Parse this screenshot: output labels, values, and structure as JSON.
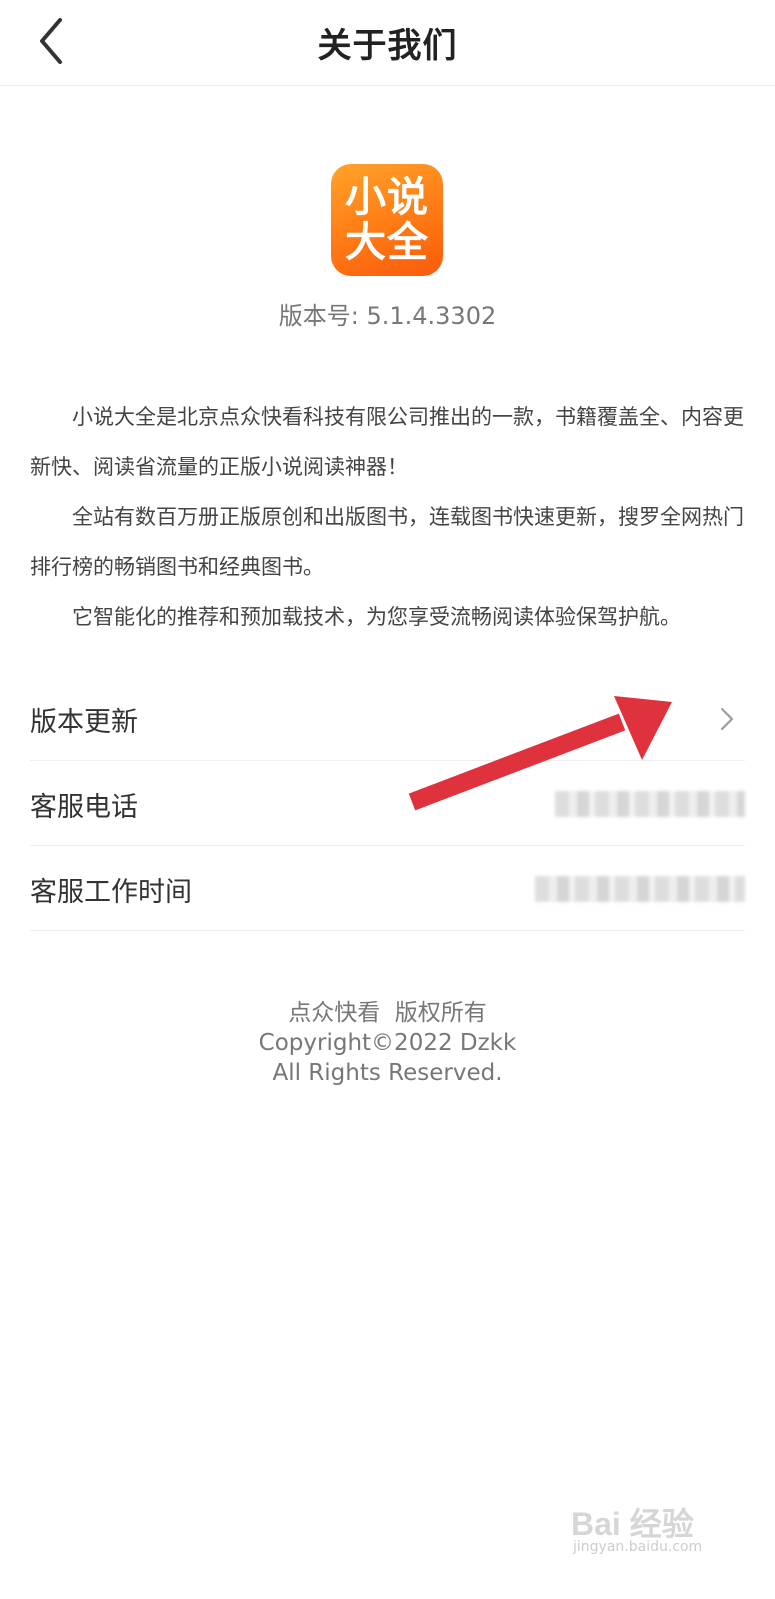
{
  "header": {
    "title": "关于我们",
    "back_icon": "chevron-left-icon"
  },
  "app": {
    "logo_line1": "小说",
    "logo_line2": "大全",
    "version_text": "版本号: 5.1.4.3302"
  },
  "description": {
    "paragraphs": [
      "小说大全是北京点众快看科技有限公司推出的一款，书籍覆盖全、内容更新快、阅读省流量的正版小说阅读神器！",
      "全站有数百万册正版原创和出版图书，连载图书快速更新，搜罗全网热门排行榜的畅销图书和经典图书。",
      "它智能化的推荐和预加载技术，为您享受流畅阅读体验保驾护航。"
    ]
  },
  "list": {
    "items": [
      {
        "label": "版本更新",
        "icon": "chevron-right-icon"
      },
      {
        "label": "客服电话"
      },
      {
        "label": "客服工作时间"
      }
    ]
  },
  "footer": {
    "line1": "点众快看  版权所有",
    "line2": "Copyright©2022 Dzkk",
    "line3": "All Rights Reserved."
  },
  "watermark": {
    "text": "Bai 经验",
    "sub": "jingyan.baidu.com"
  },
  "colors": {
    "logo_orange": "#ff7a14",
    "arrow_red": "#e0323c",
    "text_dark": "#333333",
    "text_gray": "#777777"
  }
}
